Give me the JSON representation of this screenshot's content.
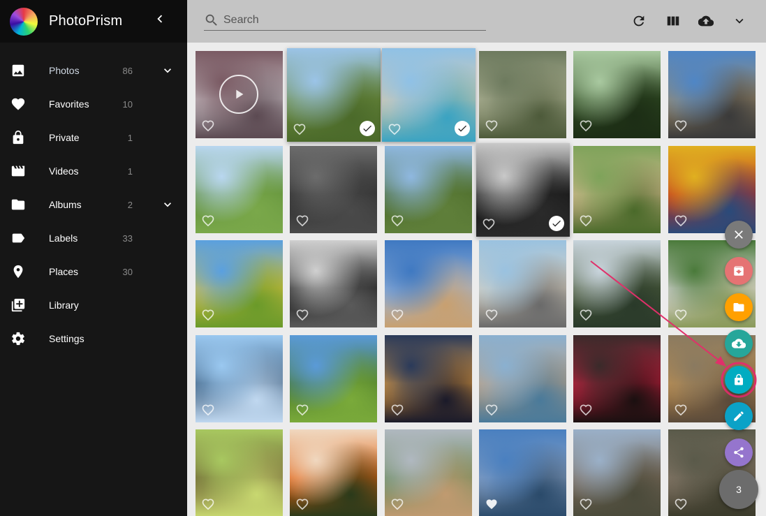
{
  "app": {
    "name": "PhotoPrism"
  },
  "sidebar": {
    "items": [
      {
        "label": "Photos",
        "count": "86",
        "icon": "image-icon",
        "chevron": true,
        "active": true
      },
      {
        "label": "Favorites",
        "count": "10",
        "icon": "heart-icon"
      },
      {
        "label": "Private",
        "count": "1",
        "icon": "lock-icon"
      },
      {
        "label": "Videos",
        "count": "1",
        "icon": "movie-icon"
      },
      {
        "label": "Albums",
        "count": "2",
        "icon": "folder-icon",
        "chevron": true
      },
      {
        "label": "Labels",
        "count": "33",
        "icon": "label-icon"
      },
      {
        "label": "Places",
        "count": "30",
        "icon": "place-icon"
      },
      {
        "label": "Library",
        "count": "",
        "icon": "library-icon"
      },
      {
        "label": "Settings",
        "count": "",
        "icon": "gear-icon"
      }
    ]
  },
  "toolbar": {
    "search_placeholder": "Search",
    "buttons": [
      "refresh-icon",
      "view-column-icon",
      "cloud-upload-icon",
      "chevron-down-icon"
    ]
  },
  "photos": [
    {
      "colors": [
        "#7a5a63",
        "#c7bfc4",
        "#5c4a52"
      ],
      "video": true
    },
    {
      "colors": [
        "#9bc4e8",
        "#6b8a3e",
        "#4b6a2a"
      ],
      "selected": true
    },
    {
      "colors": [
        "#8fc1e6",
        "#d8c9a8",
        "#3aa3c2"
      ],
      "selected": true
    },
    {
      "colors": [
        "#6d7a5e",
        "#b5b89a",
        "#4d5a3a"
      ]
    },
    {
      "colors": [
        "#a9c9a0",
        "#2f4a22",
        "#1c2d15"
      ]
    },
    {
      "colors": [
        "#4f86c6",
        "#9b8a6a",
        "#3a3a3a"
      ]
    },
    {
      "colors": [
        "#b9d7f0",
        "#5f8f3a",
        "#7aa84a"
      ]
    },
    {
      "colors": [
        "#6c6c6c",
        "#2a2a2a",
        "#4a4a4a"
      ]
    },
    {
      "colors": [
        "#8fb8e0",
        "#4a6a2a",
        "#5f7f3a"
      ]
    },
    {
      "colors": [
        "#c9c9c9",
        "#141414",
        "#2a2a2a"
      ],
      "selected": true
    },
    {
      "colors": [
        "#7ea35a",
        "#d8b890",
        "#4a6a2a"
      ]
    },
    {
      "colors": [
        "#e0b020",
        "#c03020",
        "#2a4a7a"
      ]
    },
    {
      "colors": [
        "#5aa0e0",
        "#d8c040",
        "#6a9a2a"
      ]
    },
    {
      "colors": [
        "#d0d0d0",
        "#1a1a1a",
        "#5a5a5a"
      ]
    },
    {
      "colors": [
        "#3f79c2",
        "#9ab4d8",
        "#c8a070"
      ]
    },
    {
      "colors": [
        "#9ac2e0",
        "#d8d0c0",
        "#6a6a6a"
      ]
    },
    {
      "colors": [
        "#c8d4dc",
        "#4a5a3a",
        "#2a3a2a"
      ]
    },
    {
      "colors": [
        "#4a7a3a",
        "#e8e0e8",
        "#8a9a5a"
      ]
    },
    {
      "colors": [
        "#9ac8f0",
        "#3a5a7a",
        "#c0d8f0"
      ]
    },
    {
      "colors": [
        "#5a9ad8",
        "#4a7a2a",
        "#7aaa3a"
      ]
    },
    {
      "colors": [
        "#2a3a5a",
        "#e8a040",
        "#1a1a2a"
      ]
    },
    {
      "colors": [
        "#8ab0d0",
        "#c0a080",
        "#4a7a9a"
      ]
    },
    {
      "colors": [
        "#3a2a2a",
        "#d02040",
        "#1a1010"
      ]
    },
    {
      "colors": [
        "#8a7a60",
        "#c09050",
        "#5a4a3a"
      ]
    },
    {
      "colors": [
        "#a8c860",
        "#6a5a30",
        "#c8d870"
      ]
    },
    {
      "colors": [
        "#f0d8c0",
        "#e06010",
        "#2a3a1a"
      ]
    },
    {
      "colors": [
        "#b0b8c0",
        "#6a8a5a",
        "#c09a70"
      ]
    },
    {
      "colors": [
        "#4a80c0",
        "#8aa0c0",
        "#2a4a6a"
      ],
      "favorite": true
    },
    {
      "colors": [
        "#9ab0c8",
        "#7a6a5a",
        "#4a4a3a"
      ]
    },
    {
      "colors": [
        "#5a5a4a",
        "#8a7a6a",
        "#3a3a2a"
      ]
    }
  ],
  "fabs": {
    "close": {
      "icon": "close-icon",
      "color": "#7a7a7a"
    },
    "archive": {
      "icon": "archive-icon",
      "color": "#e57373"
    },
    "album": {
      "icon": "folder-icon",
      "color": "#ffa000"
    },
    "download": {
      "icon": "cloud-download-icon",
      "color": "#26a69a"
    },
    "private": {
      "icon": "lock-icon",
      "color": "#00acc1"
    },
    "edit": {
      "icon": "pencil-icon",
      "color": "#0ba2c7"
    },
    "share": {
      "icon": "share-icon",
      "color": "#9575cd"
    },
    "count": {
      "label": "3",
      "color": "#6c6c6c"
    }
  },
  "annotation": {
    "color": "#e0306a"
  }
}
